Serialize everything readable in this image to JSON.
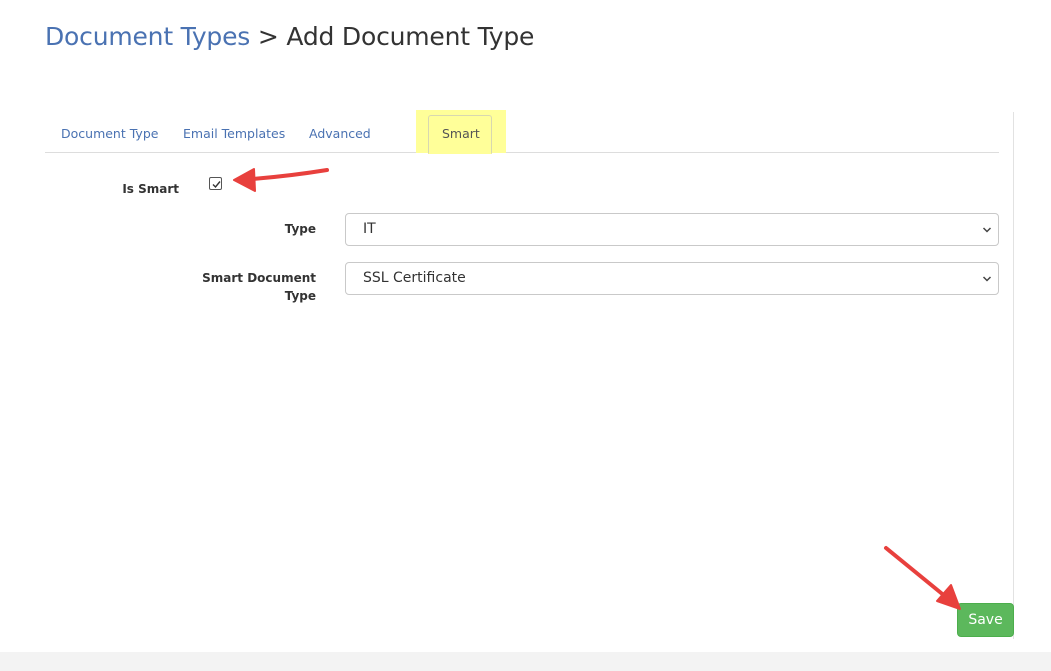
{
  "breadcrumb": {
    "parent": "Document Types",
    "separator": ">",
    "current": "Add Document Type"
  },
  "tabs": [
    {
      "label": "Document Type",
      "active": false
    },
    {
      "label": "Email Templates",
      "active": false
    },
    {
      "label": "Advanced",
      "active": false
    },
    {
      "label": "Smart",
      "active": true
    }
  ],
  "form": {
    "is_smart": {
      "label": "Is Smart",
      "checked": true
    },
    "type": {
      "label": "Type",
      "value": "IT"
    },
    "smart_document_type": {
      "label_line1": "Smart Document",
      "label_line2": "Type",
      "value": "SSL Certificate"
    }
  },
  "actions": {
    "save_label": "Save"
  },
  "colors": {
    "link": "#4a72b2",
    "highlight": "#ffff99",
    "save_green": "#5cb85c",
    "annotation_red": "#e8403d"
  }
}
